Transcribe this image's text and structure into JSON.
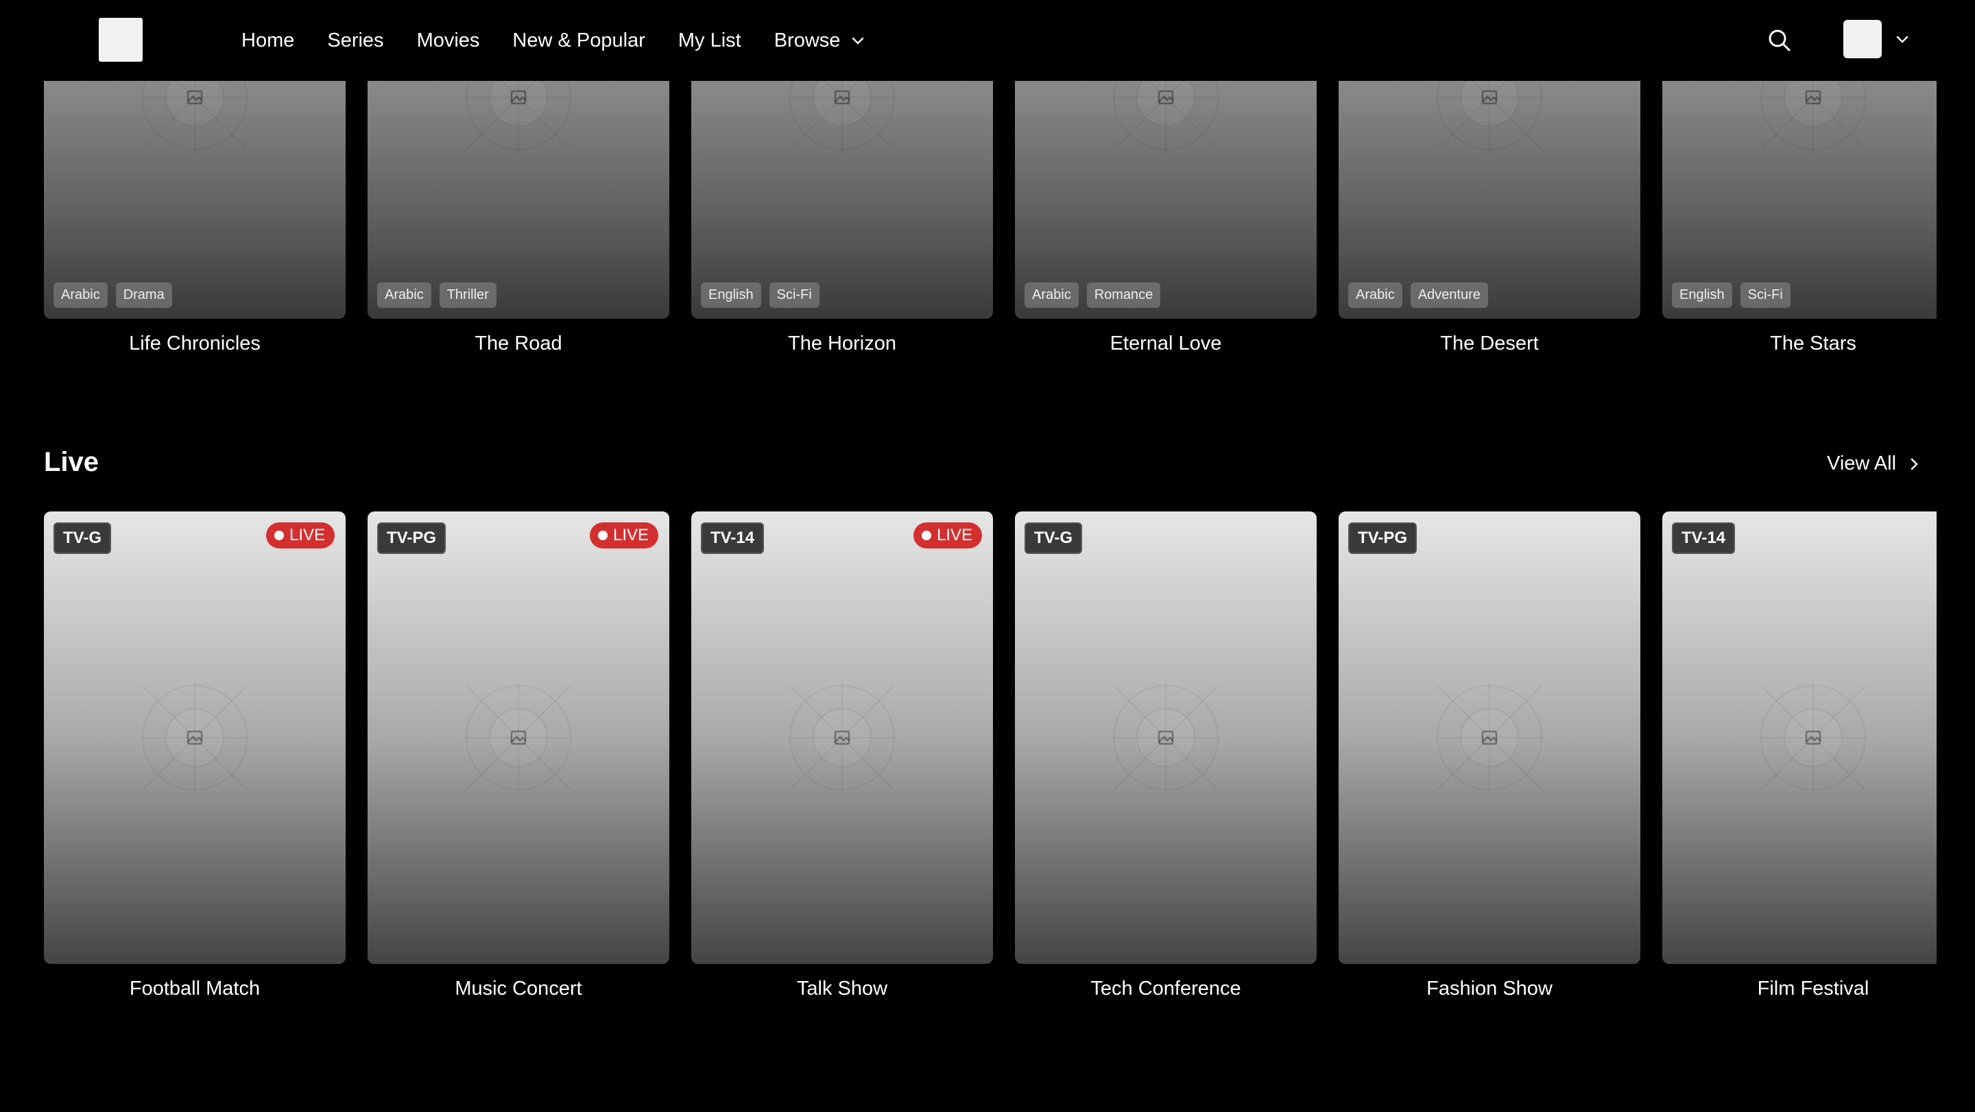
{
  "nav": {
    "items": [
      {
        "label": "Home"
      },
      {
        "label": "Series"
      },
      {
        "label": "Movies"
      },
      {
        "label": "New & Popular"
      },
      {
        "label": "My List"
      },
      {
        "label": "Browse",
        "has_dropdown": true
      }
    ]
  },
  "icons": {
    "search": "search-icon",
    "dropdown": "chevron-down-icon",
    "placeholder": "image-placeholder-icon",
    "view_all": "chevron-right-icon"
  },
  "top_row": [
    {
      "title": "Life Chronicles",
      "tags": [
        "Arabic",
        "Drama"
      ]
    },
    {
      "title": "The Road",
      "tags": [
        "Arabic",
        "Thriller"
      ]
    },
    {
      "title": "The Horizon",
      "tags": [
        "English",
        "Sci-Fi"
      ]
    },
    {
      "title": "Eternal Love",
      "tags": [
        "Arabic",
        "Romance"
      ]
    },
    {
      "title": "The Desert",
      "tags": [
        "Arabic",
        "Adventure"
      ]
    },
    {
      "title": "The Stars",
      "tags": [
        "English",
        "Sci-Fi"
      ]
    }
  ],
  "live_section": {
    "title": "Live",
    "view_all": "View All",
    "live_label": "LIVE",
    "items": [
      {
        "title": "Football Match",
        "rating": "TV-G",
        "live": true
      },
      {
        "title": "Music Concert",
        "rating": "TV-PG",
        "live": true
      },
      {
        "title": "Talk Show",
        "rating": "TV-14",
        "live": true
      },
      {
        "title": "Tech Conference",
        "rating": "TV-G",
        "live": false
      },
      {
        "title": "Fashion Show",
        "rating": "TV-PG",
        "live": false
      },
      {
        "title": "Film Festival",
        "rating": "TV-14",
        "live": false
      }
    ]
  },
  "colors": {
    "background": "#000000",
    "live_badge": "#d32f2f",
    "text": "#ffffff"
  }
}
